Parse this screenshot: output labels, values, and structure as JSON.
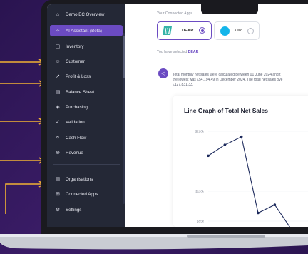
{
  "sidebar": {
    "items": [
      {
        "label": "Demo EC Overview",
        "icon": "home-icon"
      },
      {
        "label": "AI Assistant (Beta)",
        "icon": "sparkle-icon"
      },
      {
        "label": "Inventory",
        "icon": "box-icon"
      },
      {
        "label": "Customer",
        "icon": "users-icon"
      },
      {
        "label": "Profit & Loss",
        "icon": "trend-icon"
      },
      {
        "label": "Balance Sheet",
        "icon": "document-icon"
      },
      {
        "label": "Purchasing",
        "icon": "tag-icon"
      },
      {
        "label": "Validation",
        "icon": "check-shield-icon"
      },
      {
        "label": "Cash Flow",
        "icon": "cash-icon"
      },
      {
        "label": "Revenue",
        "icon": "revenue-icon"
      },
      {
        "label": "Organisations",
        "icon": "building-icon"
      },
      {
        "label": "Connected Apps",
        "icon": "grid-icon"
      },
      {
        "label": "Settings",
        "icon": "gear-icon"
      }
    ]
  },
  "main": {
    "connected_apps_label": "Your Connected Apps",
    "apps": [
      {
        "name": "DEAR",
        "selected": true
      },
      {
        "name": "Xero",
        "selected": false
      }
    ],
    "selection_prefix": "You have selected ",
    "selection_value": "DEAR",
    "message_line1": "Total monthly net sales were calculated between 01 June 2024 and t",
    "message_line2": "the lowest was £54,194.49 in December 2024. The total net sales ove",
    "message_line3": "£127,831.33."
  },
  "chart_data": {
    "type": "line",
    "title": "Line Graph of Total Net Sales",
    "y_ticks": [
      "$220k",
      "$110k",
      "$55k"
    ],
    "ylim": [
      55000,
      220000
    ],
    "values": [
      175000,
      195000,
      210000,
      70000,
      85000,
      40000,
      20000
    ],
    "color": "#1d2a5c"
  },
  "colors": {
    "accent": "#6b4bc2",
    "sidebar": "#242836",
    "arrows": "#f2b233"
  }
}
